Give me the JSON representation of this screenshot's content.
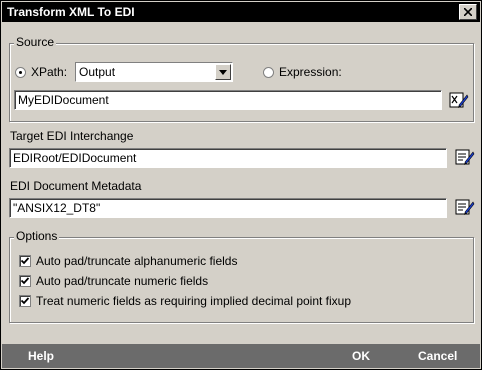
{
  "window": {
    "title": "Transform XML To EDI"
  },
  "source": {
    "legend": "Source",
    "xpath_label": "XPath:",
    "xpath_value": "Output",
    "expression_label": "Expression:",
    "document_value": "MyEDIDocument"
  },
  "target": {
    "label": "Target EDI Interchange",
    "value": "EDIRoot/EDIDocument"
  },
  "metadata": {
    "label": "EDI Document Metadata",
    "value": "\"ANSIX12_DT8\""
  },
  "options": {
    "legend": "Options",
    "items": [
      {
        "label": "Auto pad/truncate alphanumeric fields",
        "checked": true
      },
      {
        "label": "Auto pad/truncate numeric fields",
        "checked": true
      },
      {
        "label": "Treat numeric fields as requiring implied decimal point fixup",
        "checked": true
      }
    ]
  },
  "footer": {
    "help": "Help",
    "ok": "OK",
    "cancel": "Cancel"
  }
}
